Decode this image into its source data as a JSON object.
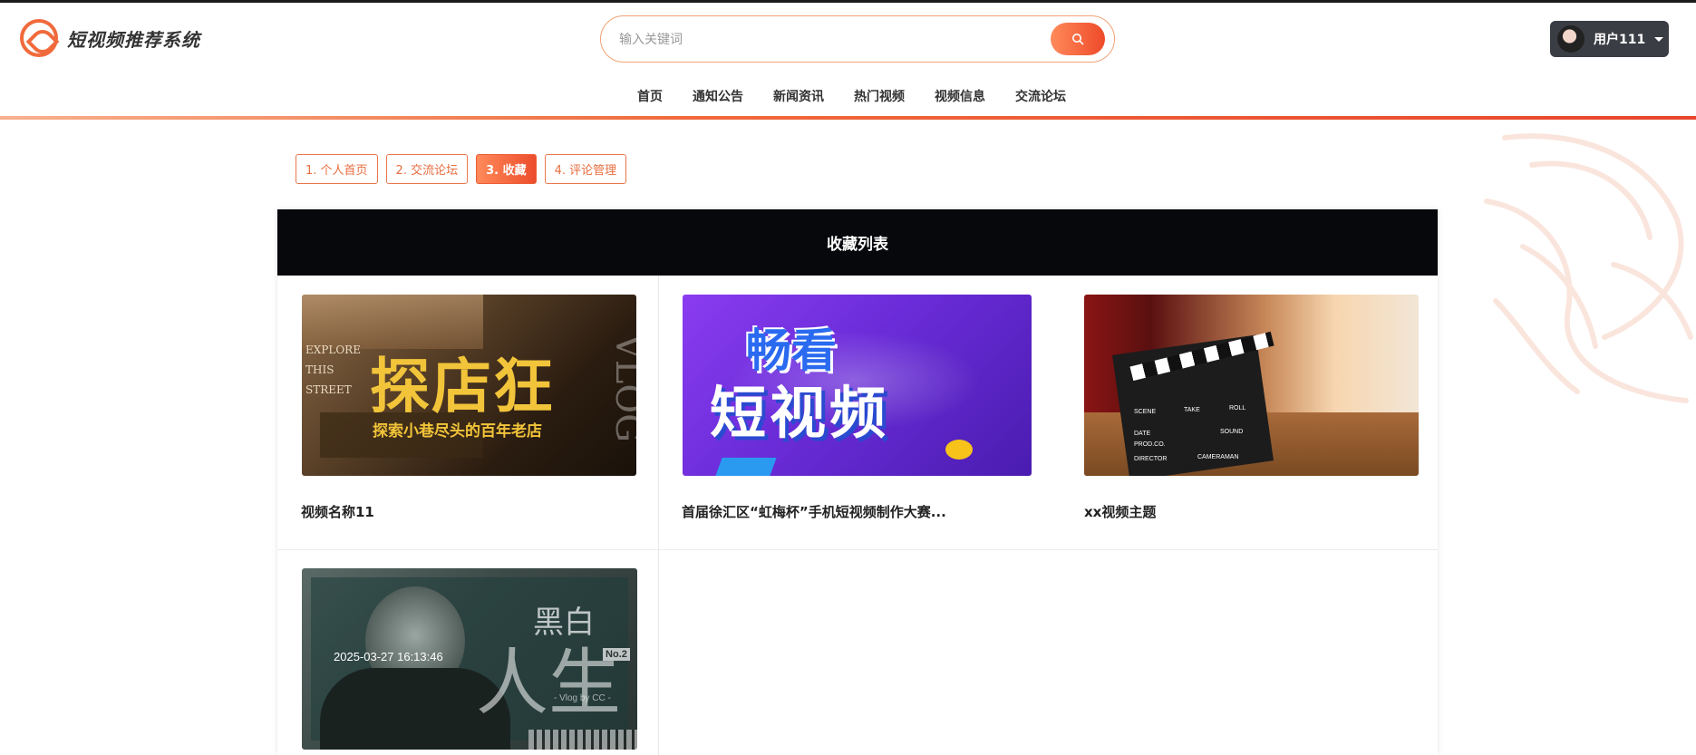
{
  "app": {
    "title": "短视频推荐系统"
  },
  "search": {
    "placeholder": "输入关键词"
  },
  "user": {
    "name": "用户111"
  },
  "nav": {
    "items": [
      "首页",
      "通知公告",
      "新闻资讯",
      "热门视频",
      "视频信息",
      "交流论坛"
    ]
  },
  "tabs": [
    {
      "label": "1. 个人首页",
      "active": false
    },
    {
      "label": "2. 交流论坛",
      "active": false
    },
    {
      "label": "3. 收藏",
      "active": true
    },
    {
      "label": "4. 评论管理",
      "active": false
    }
  ],
  "panel": {
    "title": "收藏列表"
  },
  "favorites": [
    {
      "title": "视频名称11",
      "image_text_main": "探店狂",
      "image_text_sub": "探索小巷尽头的百年老店",
      "image_text_side": "EXPLORE THIS STREET",
      "image_text_vertical": "VLOG"
    },
    {
      "title": "首届徐汇区“虹梅杯”手机短视频制作大赛...",
      "image_text_main": "畅看",
      "image_text_sub": "短视频"
    },
    {
      "title": "xx视频主题",
      "image_text_clapper": [
        "SCENE",
        "TAKE",
        "ROLL",
        "DATE",
        "SOUND",
        "PROD.CO.",
        "DIRECTOR",
        "CAMERAMAN"
      ]
    },
    {
      "title": "",
      "timestamp": "2025-03-27 16:13:46",
      "image_text_main": "人生",
      "image_text_top": "黑白",
      "image_text_badge": "No.2",
      "image_text_sign": "- Vlog by CC -"
    }
  ],
  "colors": {
    "accent": "#f06a3c",
    "accent_dark": "#e8452c",
    "panel_header": "#07080c",
    "user_badge": "#3b3d44"
  },
  "icons": {
    "search": "search-icon",
    "caret": "chevron-down-icon",
    "logo": "logo-icon"
  }
}
